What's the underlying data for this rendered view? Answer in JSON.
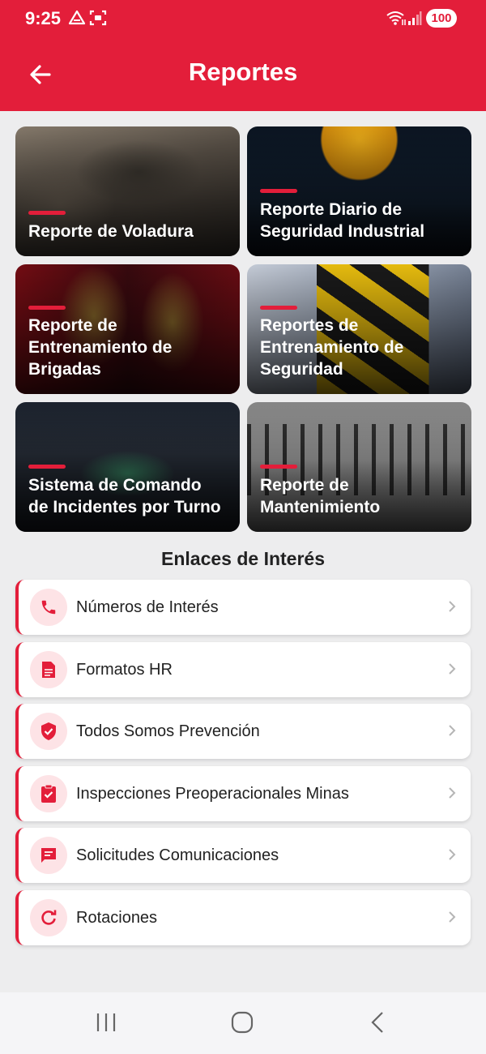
{
  "status_bar": {
    "time": "9:25",
    "battery": "100",
    "icons": [
      "drive-icon",
      "screenshot-icon",
      "wifi-icon",
      "signal-icon",
      "battery-icon"
    ]
  },
  "header": {
    "title": "Reportes",
    "back_icon": "arrow-left-icon"
  },
  "reports": [
    {
      "title": "Reporte de Voladura"
    },
    {
      "title": "Reporte Diario de\nSeguridad Industrial"
    },
    {
      "title": "Reporte de\nEntrenamiento de\nBrigadas"
    },
    {
      "title": "Reportes de\nEntrenamiento de\nSeguridad"
    },
    {
      "title": "Sistema de Comando\nde Incidentes por Turno"
    },
    {
      "title": "Reporte de\nMantenimiento"
    }
  ],
  "links_section": {
    "title": "Enlaces de Interés",
    "items": [
      {
        "label": "Números de Interés",
        "icon": "phone-icon"
      },
      {
        "label": "Formatos HR",
        "icon": "document-icon"
      },
      {
        "label": "Todos Somos Prevención",
        "icon": "shield-check-icon"
      },
      {
        "label": "Inspecciones Preoperacionales Minas",
        "icon": "clipboard-check-icon"
      },
      {
        "label": "Solicitudes Comunicaciones",
        "icon": "message-icon"
      },
      {
        "label": "Rotaciones",
        "icon": "refresh-icon"
      }
    ]
  },
  "colors": {
    "brand": "#e31e3a",
    "icon_bg": "#fde3e6"
  }
}
